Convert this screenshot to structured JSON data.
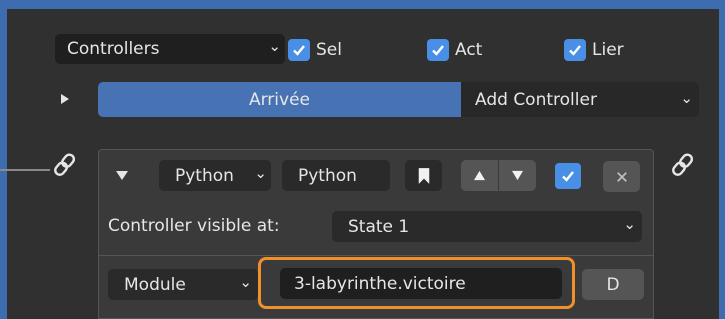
{
  "header": {
    "dropdown_value": "Controllers",
    "sel_label": "Sel",
    "act_label": "Act",
    "lier_label": "Lier",
    "sel_checked": true,
    "act_checked": true,
    "lier_checked": true
  },
  "object_row": {
    "object_name": "Arrivée",
    "add_controller_label": "Add Controller"
  },
  "controller": {
    "type_value": "Python",
    "name_value": "Python",
    "enabled": true,
    "visible_at_label": "Controller visible at:",
    "state_value": "State 1",
    "mode_value": "Module",
    "module_value": "3-labyrinthe.victoire",
    "debug_label": "D"
  },
  "colors": {
    "accent": "#4a8fe6",
    "highlight_frame": "#f0902a",
    "background": "#303030",
    "outer": "#3d6db0"
  }
}
